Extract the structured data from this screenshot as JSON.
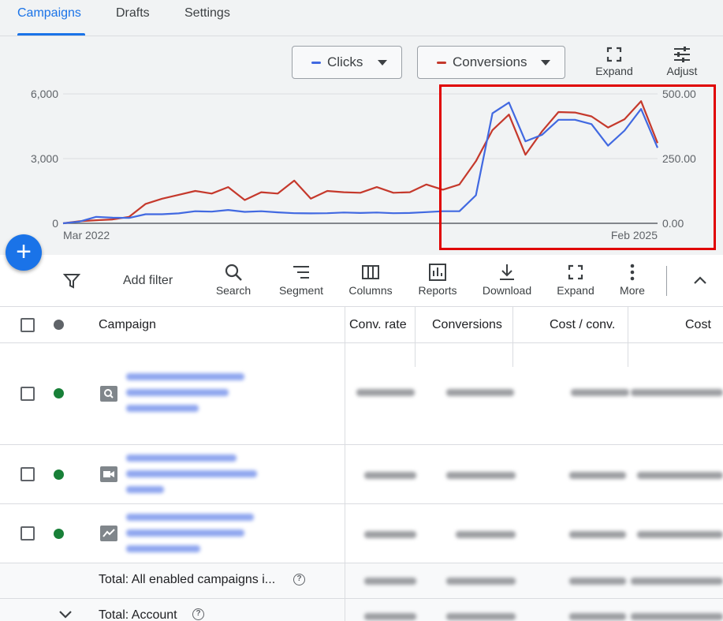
{
  "tabs": [
    {
      "label": "Campaigns",
      "active": true
    },
    {
      "label": "Drafts",
      "active": false
    },
    {
      "label": "Settings",
      "active": false
    }
  ],
  "chart_controls": {
    "metric1": {
      "label": "Clicks",
      "color": "#4169e1"
    },
    "metric2": {
      "label": "Conversions",
      "color": "#c5392c"
    },
    "expand_label": "Expand",
    "adjust_label": "Adjust"
  },
  "chart_data": {
    "type": "line",
    "x_start_label": "Mar 2022",
    "x_end_label": "Feb 2025",
    "y_left": {
      "ticks": [
        "6,000",
        "3,000",
        "0"
      ],
      "max": 6000
    },
    "y_right": {
      "ticks": [
        "500.00",
        "250.00",
        "0.00"
      ],
      "max": 500
    },
    "grid": true,
    "series": [
      {
        "name": "Clicks",
        "axis": "left",
        "color": "#4169e1",
        "values": [
          0,
          80,
          300,
          260,
          250,
          420,
          420,
          460,
          560,
          540,
          620,
          530,
          560,
          510,
          470,
          460,
          470,
          500,
          480,
          500,
          470,
          480,
          520,
          560,
          560,
          1300,
          5100,
          5600,
          3800,
          4100,
          4800,
          4800,
          4600,
          3600,
          4300,
          5300,
          3500
        ]
      },
      {
        "name": "Conversions",
        "axis": "right",
        "color": "#c5392c",
        "values": [
          0,
          8,
          12,
          15,
          25,
          75,
          95,
          110,
          125,
          115,
          140,
          90,
          120,
          115,
          165,
          95,
          125,
          120,
          118,
          140,
          118,
          120,
          150,
          130,
          150,
          240,
          360,
          420,
          265,
          355,
          430,
          428,
          413,
          370,
          402,
          472,
          310
        ]
      }
    ]
  },
  "toolbar": {
    "add_filter": "Add filter",
    "buttons": [
      "Search",
      "Segment",
      "Columns",
      "Reports",
      "Download",
      "Expand",
      "More"
    ]
  },
  "table": {
    "headers": {
      "campaign": "Campaign",
      "conv_rate": "Conv. rate",
      "conversions": "Conversions",
      "cost_conv": "Cost / conv.",
      "cost": "Cost"
    },
    "status_color": "#188038",
    "totals": {
      "enabled": "Total: All enabled campaigns i...",
      "account": "Total: Account"
    }
  }
}
